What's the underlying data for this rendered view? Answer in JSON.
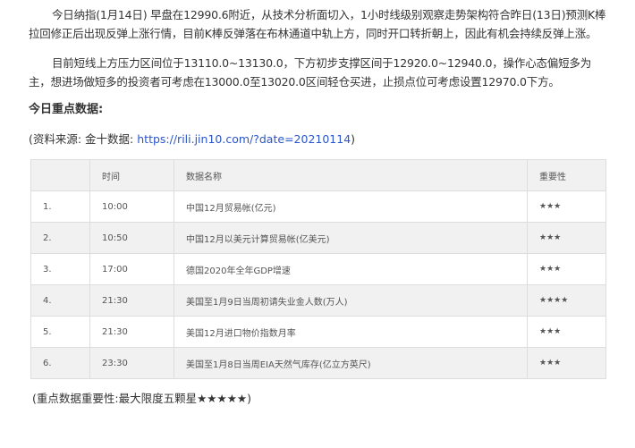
{
  "article": {
    "paragraph1": "今日纳指(1月14日) 早盘在12990.6附近，从技术分析面切入，1小时线级别观察走势架构符合昨日(13日)预测K棒拉回修正后出现反弹上涨行情，目前K棒反弹落在布林通道中轨上方，同时开口转折朝上，因此有机会持续反弹上涨。",
    "paragraph2": "目前短线上方压力区间位于13110.0~13130.0，下方初步支撑区间于12920.0~12940.0，操作心态偏短多为主，想进场做短多的投资者可考虑在13000.0至13020.0区间轻仓买进，止损点位可考虑设置12970.0下方。",
    "heading": "今日重点数据:",
    "source_prefix": "(资料来源: 金十数据: ",
    "source_link": "https://rili.jin10.com/?date=20210114",
    "source_suffix": ")",
    "note": "(重点数据重要性:最大限度五颗星★★★★★)"
  },
  "table": {
    "headers": [
      "",
      "时间",
      "数据名称",
      "重要性"
    ],
    "rows": [
      {
        "no": "1.",
        "time": "10:00",
        "name": "中国12月贸易帐(亿元)",
        "stars": "★★★"
      },
      {
        "no": "2.",
        "time": "10:50",
        "name": "中国12月以美元计算贸易帐(亿美元)",
        "stars": "★★★"
      },
      {
        "no": "3.",
        "time": "17:00",
        "name": "德国2020年全年GDP增速",
        "stars": "★★★"
      },
      {
        "no": "4.",
        "time": "21:30",
        "name": "美国至1月9日当周初请失业金人数(万人)",
        "stars": "★★★★"
      },
      {
        "no": "5.",
        "time": "21:30",
        "name": "美国12月进口物价指数月率",
        "stars": "★★★"
      },
      {
        "no": "6.",
        "time": "23:30",
        "name": "美国至1月8日当周EIA天然气库存(亿立方英尺)",
        "stars": "★★★"
      }
    ]
  }
}
